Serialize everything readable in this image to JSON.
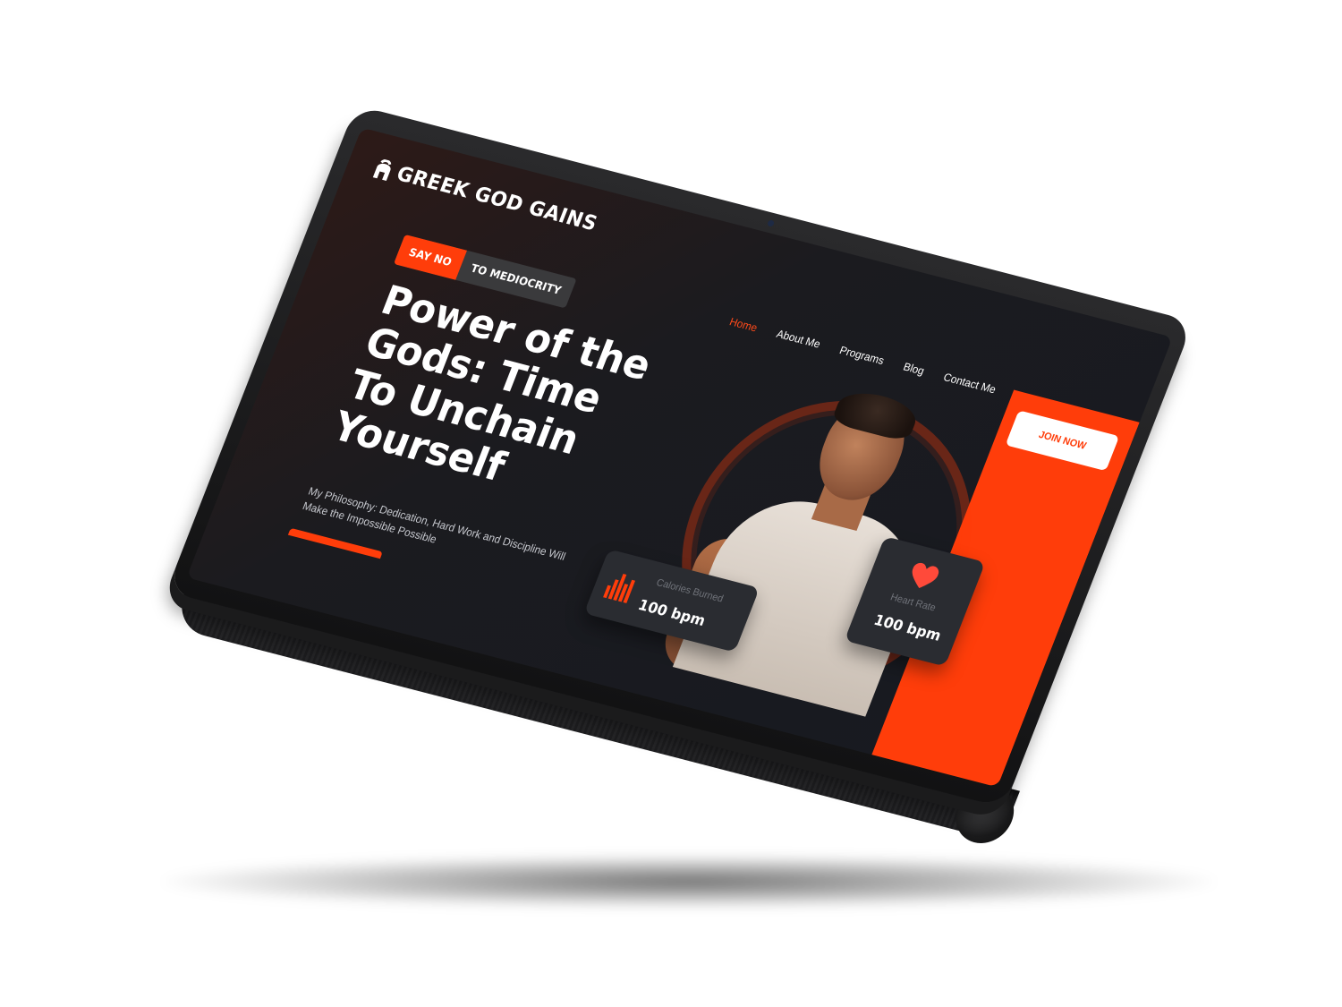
{
  "site": {
    "logo_text": "GREEK GOD GAINS"
  },
  "nav": {
    "items": [
      {
        "label": "Home",
        "active": true
      },
      {
        "label": "About Me",
        "active": false
      },
      {
        "label": "Programs",
        "active": false
      },
      {
        "label": "Blog",
        "active": false
      },
      {
        "label": "Contact Me",
        "active": false
      }
    ],
    "join_label": "JOIN NOW"
  },
  "hero": {
    "badge_highlight": "SAY NO",
    "badge_rest": "TO MEDIOCRITY",
    "headline": "Power of the Gods: Time To Unchain Yourself",
    "philosophy": "My Philosophy: Dedication, Hard Work and Discipline Will Make the Impossible Possible"
  },
  "stats": {
    "calories": {
      "label": "Calories Burned",
      "value": "100 bpm",
      "icon": "bar-chart-icon"
    },
    "heart": {
      "label": "Heart Rate",
      "value": "100 bpm",
      "icon": "heart-icon"
    }
  },
  "colors": {
    "accent": "#ff3d0a",
    "background": "#171a21",
    "card": "#2a2c31"
  }
}
